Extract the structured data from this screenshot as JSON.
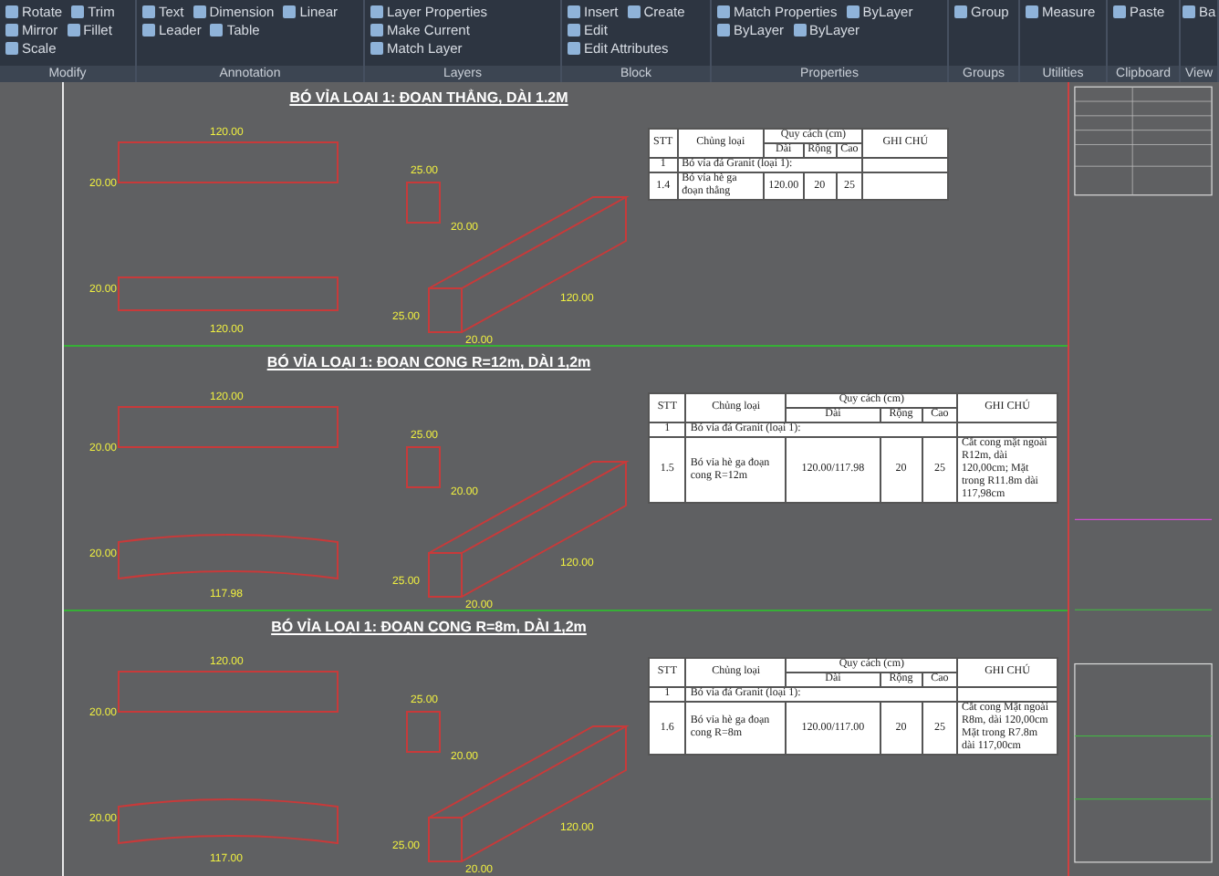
{
  "ribbon": {
    "panels": [
      {
        "title": "Modify",
        "tools": [
          "Rotate",
          "Trim",
          "Mirror",
          "Fillet",
          "Scale"
        ]
      },
      {
        "title": "Annotation",
        "tools": [
          "Text",
          "Dimension",
          "Linear",
          "Leader",
          "Table"
        ]
      },
      {
        "title": "Layers",
        "tools": [
          "Layer Properties",
          "Make Current",
          "Match Layer"
        ]
      },
      {
        "title": "Block",
        "tools": [
          "Insert",
          "Create",
          "Edit",
          "Edit Attributes"
        ]
      },
      {
        "title": "Properties",
        "tools": [
          "Match Properties",
          "ByLayer",
          "ByLayer",
          "ByLayer"
        ]
      },
      {
        "title": "Groups",
        "tools": [
          "Group"
        ]
      },
      {
        "title": "Utilities",
        "tools": [
          "Measure"
        ]
      },
      {
        "title": "Clipboard",
        "tools": [
          "Paste"
        ]
      },
      {
        "title": "View",
        "tools": [
          "Ba"
        ]
      }
    ]
  },
  "sections": [
    {
      "title": "BÓ VỈA LOẠI 1: ĐOẠN THẲNG, DÀI 1.2M",
      "kind": "straight",
      "dims": [
        "120.00",
        "20.00",
        "25.00",
        "20.00",
        "120.00",
        "20.00",
        "25.00",
        "20.00",
        "120.00"
      ],
      "table": {
        "headers": [
          "STT",
          "Chủng loại",
          "Quy cách (cm)",
          "Dài",
          "Rộng",
          "Cao",
          "GHI CHÚ"
        ],
        "group_row": [
          "1",
          "Bó vỉa đá Granit (loại 1):"
        ],
        "item": {
          "stt": "1.4",
          "name": "Bó vỉa hè ga đoạn thẳng",
          "dai": "120.00",
          "rong": "20",
          "cao": "25"
        }
      }
    },
    {
      "title": "BÓ VỈA LOẠI 1: ĐOẠN CONG R=12m, DÀI 1,2m",
      "kind": "curved",
      "dims": [
        "120.00",
        "20.00",
        "25.00",
        "20.00",
        "117.98",
        "20.00",
        "25.00",
        "20.00",
        "120.00"
      ],
      "table": {
        "headers": [
          "STT",
          "Chủng loại",
          "Quy cách (cm)",
          "Dài",
          "Rộng",
          "Cao",
          "GHI CHÚ"
        ],
        "group_row": [
          "1",
          "Bó vỉa đá Granit (loại 1):"
        ],
        "item": {
          "stt": "1.5",
          "name": "Bó vỉa hè ga đoạn cong R=12m",
          "dai": "120.00/117.98",
          "rong": "20",
          "cao": "25",
          "note": "Cắt cong mặt ngoài R12m, dài 120,00cm; Mặt trong R11.8m dài 117,98cm"
        }
      }
    },
    {
      "title": "BÓ VỈA LOẠI 1: ĐOẠN CONG R=8m, DÀI 1,2m",
      "kind": "curved",
      "dims": [
        "120.00",
        "20.00",
        "25.00",
        "20.00",
        "117.00",
        "20.00",
        "25.00",
        "20.00",
        "120.00"
      ],
      "table": {
        "headers": [
          "STT",
          "Chủng loại",
          "Quy cách (cm)",
          "Dài",
          "Rộng",
          "Cao",
          "GHI CHÚ"
        ],
        "group_row": [
          "1",
          "Bó vỉa đá Granit (loại 1):"
        ],
        "item": {
          "stt": "1.6",
          "name": "Bó vỉa hè ga đoạn cong R=8m",
          "dai": "120.00/117.00",
          "rong": "20",
          "cao": "25",
          "note": "Cắt cong Mặt ngoài R8m, dài 120,00cm Mặt trong R7.8m dài 117,00cm"
        }
      }
    }
  ]
}
